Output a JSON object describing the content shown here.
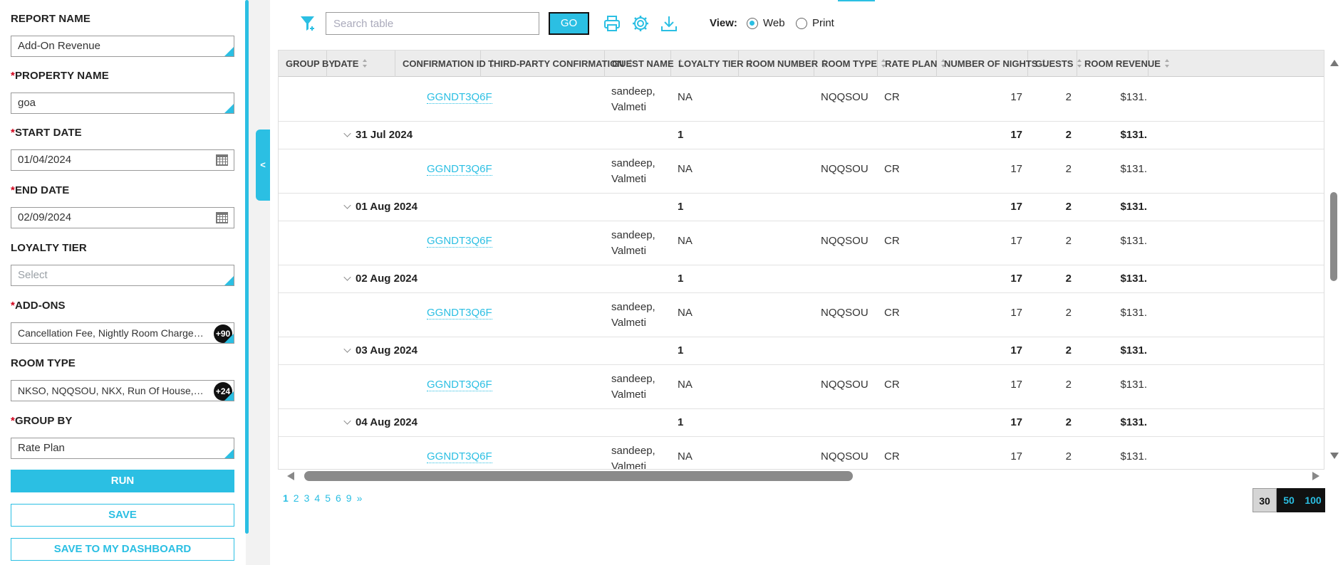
{
  "form": {
    "report_name": {
      "label": "REPORT NAME",
      "value": "Add-On Revenue"
    },
    "property_name": {
      "label": "PROPERTY NAME",
      "value": "goa"
    },
    "start_date": {
      "label": "START DATE",
      "value": "01/04/2024"
    },
    "end_date": {
      "label": "END DATE",
      "value": "02/09/2024"
    },
    "loyalty_tier": {
      "label": "LOYALTY TIER",
      "placeholder": "Select"
    },
    "add_ons": {
      "label": "ADD-ONS",
      "value": "Cancellation Fee, Nightly Room Charge, G...",
      "count": "+90"
    },
    "room_type": {
      "label": "ROOM TYPE",
      "value": "NKSO, NQQSOU, NKX, Run Of House, S...",
      "count": "+24"
    },
    "group_by": {
      "label": "GROUP BY",
      "value": "Rate Plan"
    },
    "required_mark": "*",
    "run_label": "RUN",
    "save_label": "SAVE",
    "save_dashboard_label": "SAVE TO MY DASHBOARD"
  },
  "collapse_tab": "<",
  "toolbar": {
    "search_placeholder": "Search table",
    "go_label": "GO",
    "view_label": "View:",
    "web_label": "Web",
    "print_label": "Print",
    "selected_view": "Web"
  },
  "table": {
    "columns": [
      "GROUP BY",
      "DATE",
      "CONFIRMATION ID",
      "THIRD-PARTY CONFIRMATION",
      "GUEST NAME",
      "LOYALTY TIER",
      "ROOM NUMBER",
      "ROOM TYPE",
      "RATE PLAN",
      "NUMBER OF NIGHTS",
      "GUESTS",
      "ROOM REVENUE"
    ],
    "rows": [
      {
        "kind": "detail",
        "confirmation_id": "GGNDT3Q6F",
        "guest_name": "sandeep, Valmeti",
        "loyalty_tier": "NA",
        "room_type": "NQQSOU",
        "rate_plan": "CR",
        "nights": "17",
        "guests": "2",
        "room_revenue": "$131."
      },
      {
        "kind": "group",
        "date": "31 Jul 2024",
        "count": "1",
        "nights": "17",
        "guests": "2",
        "room_revenue": "$131."
      },
      {
        "kind": "detail",
        "confirmation_id": "GGNDT3Q6F",
        "guest_name": "sandeep, Valmeti",
        "loyalty_tier": "NA",
        "room_type": "NQQSOU",
        "rate_plan": "CR",
        "nights": "17",
        "guests": "2",
        "room_revenue": "$131."
      },
      {
        "kind": "group",
        "date": "01 Aug 2024",
        "count": "1",
        "nights": "17",
        "guests": "2",
        "room_revenue": "$131."
      },
      {
        "kind": "detail",
        "confirmation_id": "GGNDT3Q6F",
        "guest_name": "sandeep, Valmeti",
        "loyalty_tier": "NA",
        "room_type": "NQQSOU",
        "rate_plan": "CR",
        "nights": "17",
        "guests": "2",
        "room_revenue": "$131."
      },
      {
        "kind": "group",
        "date": "02 Aug 2024",
        "count": "1",
        "nights": "17",
        "guests": "2",
        "room_revenue": "$131."
      },
      {
        "kind": "detail",
        "confirmation_id": "GGNDT3Q6F",
        "guest_name": "sandeep, Valmeti",
        "loyalty_tier": "NA",
        "room_type": "NQQSOU",
        "rate_plan": "CR",
        "nights": "17",
        "guests": "2",
        "room_revenue": "$131."
      },
      {
        "kind": "group",
        "date": "03 Aug 2024",
        "count": "1",
        "nights": "17",
        "guests": "2",
        "room_revenue": "$131."
      },
      {
        "kind": "detail",
        "confirmation_id": "GGNDT3Q6F",
        "guest_name": "sandeep, Valmeti",
        "loyalty_tier": "NA",
        "room_type": "NQQSOU",
        "rate_plan": "CR",
        "nights": "17",
        "guests": "2",
        "room_revenue": "$131."
      },
      {
        "kind": "group",
        "date": "04 Aug 2024",
        "count": "1",
        "nights": "17",
        "guests": "2",
        "room_revenue": "$131."
      },
      {
        "kind": "detail",
        "confirmation_id": "GGNDT3Q6F",
        "guest_name": "sandeep, Valmeti",
        "loyalty_tier": "NA",
        "room_type": "NQQSOU",
        "rate_plan": "CR",
        "nights": "17",
        "guests": "2",
        "room_revenue": "$131."
      }
    ]
  },
  "pagination": {
    "pages": [
      "1",
      "2",
      "3",
      "4",
      "5",
      "6",
      "9",
      "»"
    ],
    "current": "1",
    "page_sizes": [
      "30",
      "50",
      "100"
    ],
    "selected_size": "30"
  },
  "colors": {
    "accent": "#2bbfe3",
    "required": "#d0021b"
  },
  "icons": [
    "filter-icon",
    "print-icon",
    "settings-icon",
    "download-icon",
    "calendar-icon"
  ]
}
